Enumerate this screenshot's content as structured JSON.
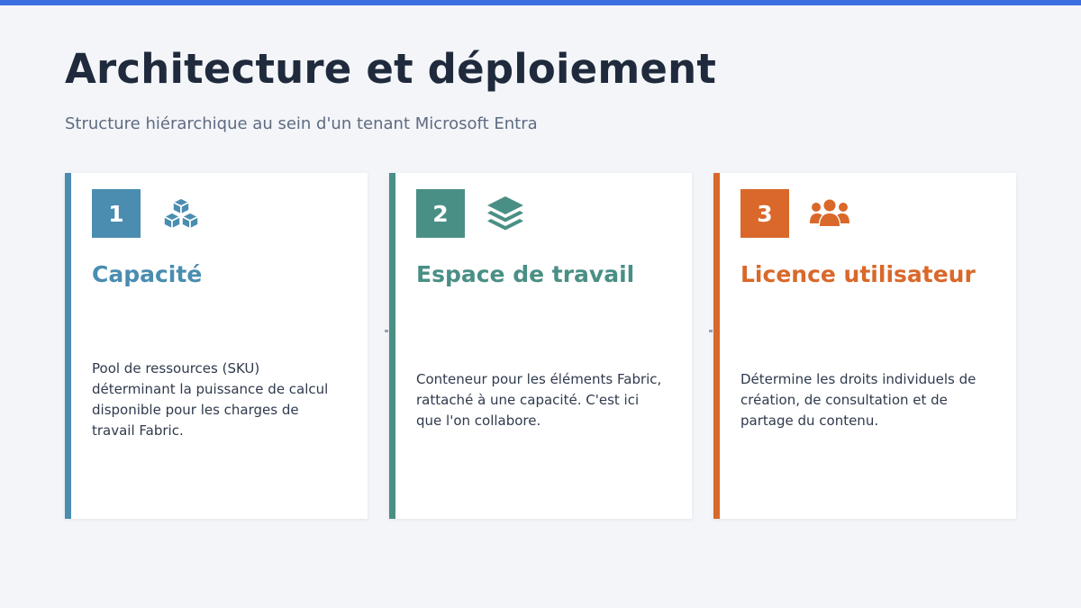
{
  "header": {
    "title": "Architecture et déploiement",
    "subtitle": "Structure hiérarchique au sein d'un tenant Microsoft Entra"
  },
  "colors": {
    "top_bar": "#3b6fe0",
    "capacity": "#4a8db0",
    "workspace": "#4a8f85",
    "license": "#d9682a"
  },
  "cards": [
    {
      "number": "1",
      "icon": "cubes-icon",
      "title": "Capacité",
      "description": "Pool de ressources (SKU) déterminant la puissance de calcul disponible pour les charges de travail Fabric."
    },
    {
      "number": "2",
      "icon": "layers-icon",
      "title": "Espace de travail",
      "description": "Conteneur pour les éléments Fabric, rattaché à une capacité. C'est ici que l'on collabore."
    },
    {
      "number": "3",
      "icon": "users-icon",
      "title": "Licence utilisateur",
      "description": "Détermine les droits individuels de création, de consultation et de partage du contenu."
    }
  ]
}
